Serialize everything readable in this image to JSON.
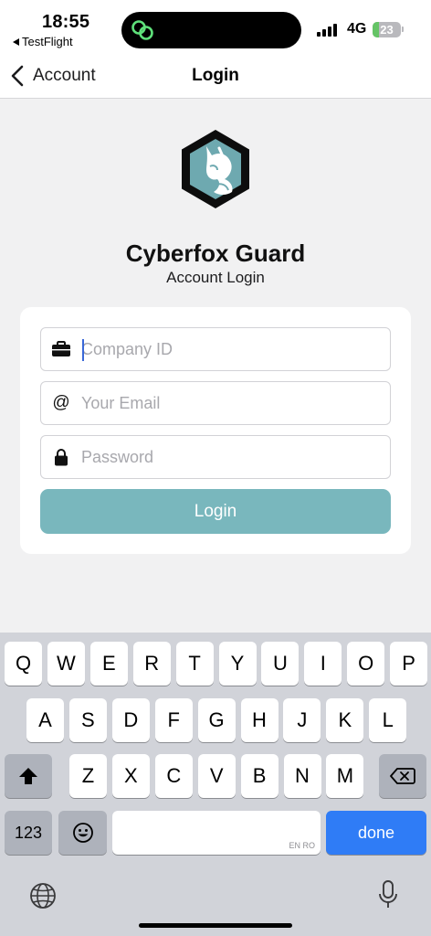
{
  "status_bar": {
    "time": "18:55",
    "back_app": "TestFlight",
    "network": "4G",
    "battery": "23",
    "battery_level": 0.23
  },
  "nav": {
    "back_label": "Account",
    "title": "Login"
  },
  "brand": {
    "name": "Cyberfox Guard",
    "subtitle": "Account Login"
  },
  "form": {
    "company_id": {
      "placeholder": "Company ID",
      "value": ""
    },
    "email": {
      "placeholder": "Your Email",
      "value": ""
    },
    "password": {
      "placeholder": "Password",
      "value": ""
    },
    "login_label": "Login"
  },
  "keyboard": {
    "row1": [
      "Q",
      "W",
      "E",
      "R",
      "T",
      "Y",
      "U",
      "I",
      "O",
      "P"
    ],
    "row2": [
      "A",
      "S",
      "D",
      "F",
      "G",
      "H",
      "J",
      "K",
      "L"
    ],
    "row3": [
      "Z",
      "X",
      "C",
      "V",
      "B",
      "N",
      "M"
    ],
    "numbers_label": "123",
    "done_label": "done",
    "space_language": "EN RO"
  },
  "colors": {
    "accent": "#79b7bd",
    "done": "#2f7cf6",
    "logo_teal": "#6ea9b0",
    "battery_green": "#65c466"
  }
}
